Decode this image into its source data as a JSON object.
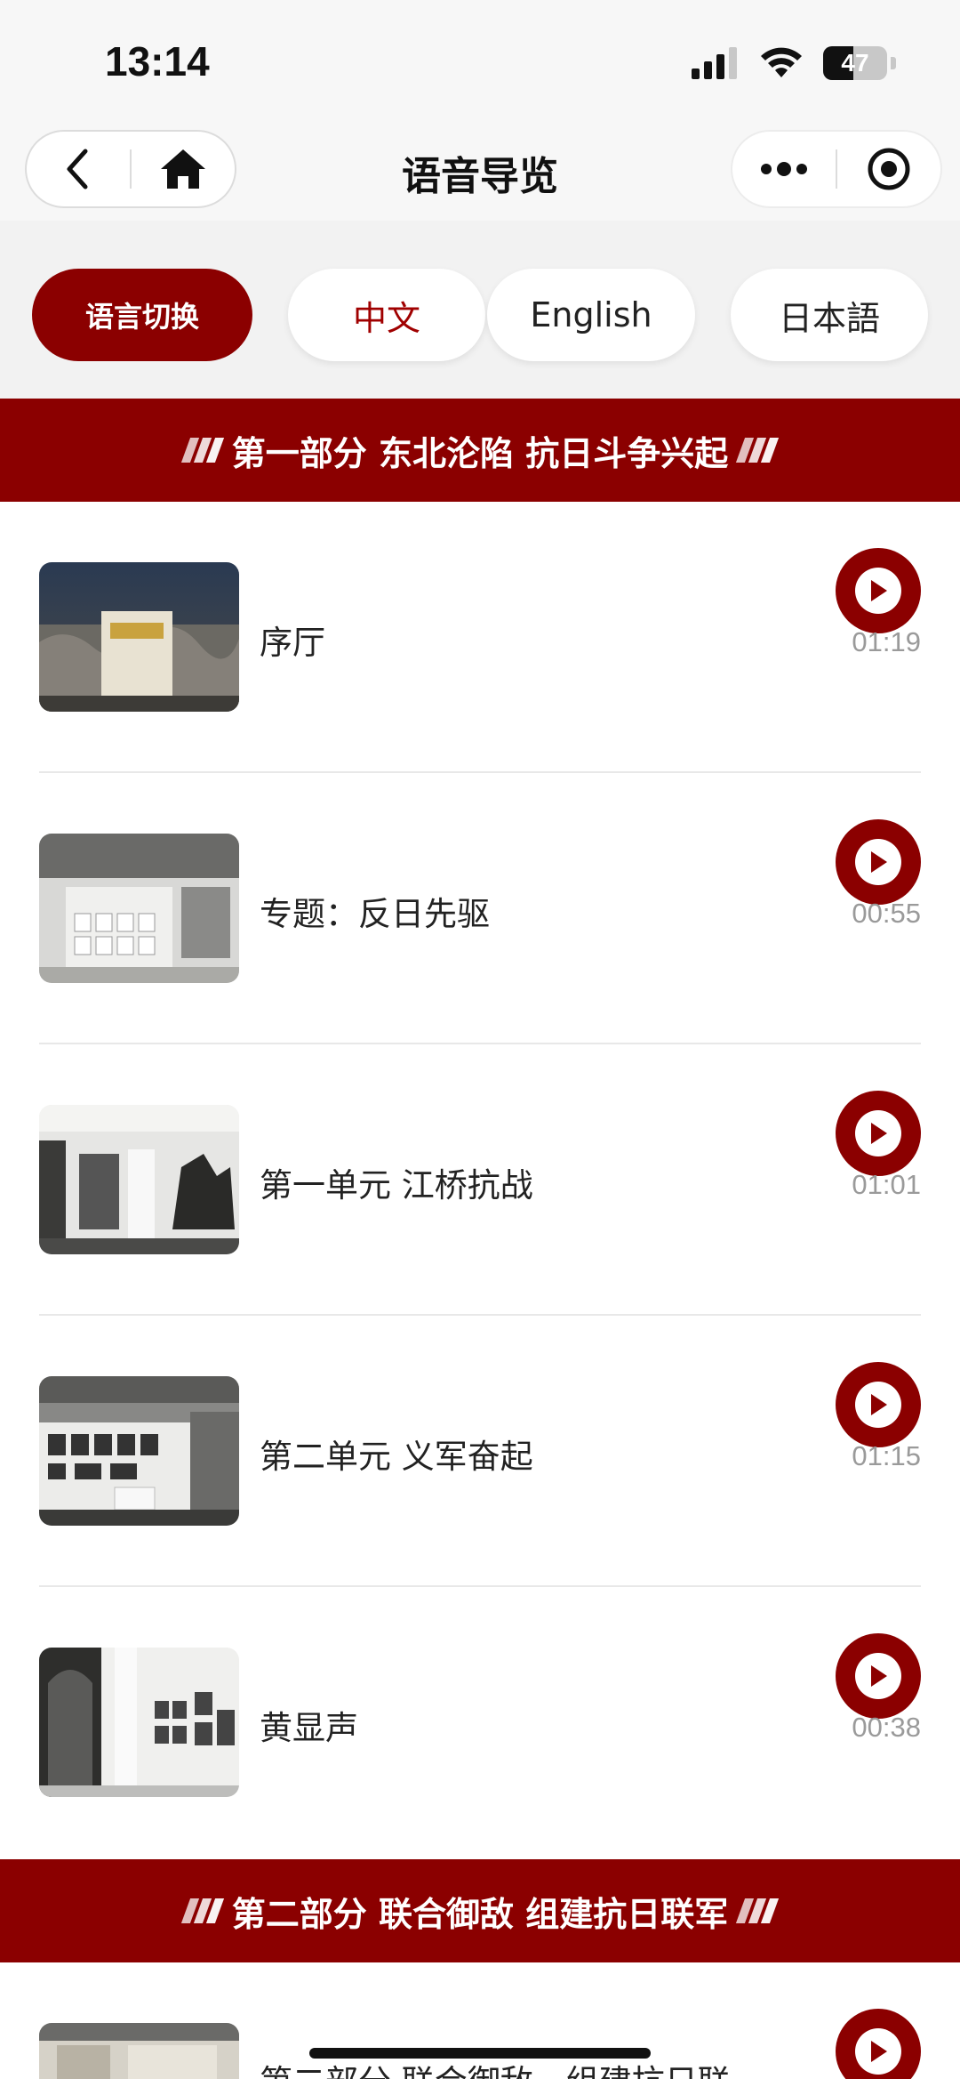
{
  "status_bar": {
    "time": "13:14",
    "battery_percent": 47,
    "battery_text": "47"
  },
  "nav": {
    "title": "语音导览",
    "icons": [
      "back-icon",
      "home-icon",
      "more-icon",
      "record-icon"
    ]
  },
  "language": {
    "label": "语言切换",
    "options": [
      {
        "label": "中文",
        "active": true
      },
      {
        "label": "English",
        "active": false
      },
      {
        "label": "日本語",
        "active": false
      }
    ]
  },
  "sections": [
    {
      "title": "第一部分 东北沦陷 抗日斗争兴起",
      "items": [
        {
          "title": "序厅",
          "duration": "01:19"
        },
        {
          "title": "专题：反日先驱",
          "duration": "00:55"
        },
        {
          "title": "第一单元 江桥抗战",
          "duration": "01:01"
        },
        {
          "title": "第二单元 义军奋起",
          "duration": "01:15"
        },
        {
          "title": "黄显声",
          "duration": "00:38"
        }
      ]
    },
    {
      "title": "第二部分 联合御敌 组建抗日联军",
      "items": [
        {
          "title": "第二部分 联合御敌，组建抗日联",
          "duration": ""
        }
      ]
    }
  ],
  "colors": {
    "brand": "#8b0000",
    "active_text": "#a00000",
    "muted": "#9a9a9a"
  }
}
